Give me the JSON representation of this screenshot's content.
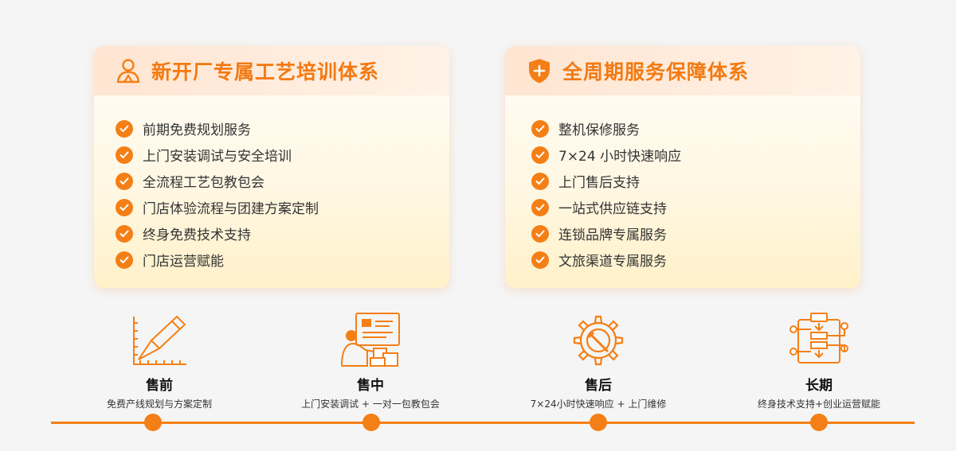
{
  "colors": {
    "accent": "#f47f16",
    "title_orange": "#f37a12",
    "background": "#f5f5f5"
  },
  "left_card": {
    "icon": "trainer-person-icon",
    "title": "新开厂专属工艺培训体系",
    "items": [
      "前期免费规划服务",
      "上门安装调试与安全培训",
      "全流程工艺包教包会",
      "门店体验流程与团建方案定制",
      "终身免费技术支持",
      "门店运营赋能"
    ]
  },
  "right_card": {
    "icon": "shield-plus-icon",
    "title": "全周期服务保障体系",
    "items": [
      "整机保修服务",
      "7×24 小时快速响应",
      "上门售后支持",
      "一站式供应链支持",
      "连锁品牌专属服务",
      "文旅渠道专属服务"
    ]
  },
  "steps": [
    {
      "icon": "ruler-pencil-icon",
      "title": "售前",
      "subtitle": "免费产线规划与方案定制"
    },
    {
      "icon": "training-board-icon",
      "title": "售中",
      "subtitle": "上门安装调试 + 一对一包教包会"
    },
    {
      "icon": "gear-wrench-icon",
      "title": "售后",
      "subtitle": "7×24小时快速响应 + 上门维修"
    },
    {
      "icon": "process-flow-icon",
      "title": "长期",
      "subtitle": "终身技术支持+创业运营赋能"
    }
  ]
}
